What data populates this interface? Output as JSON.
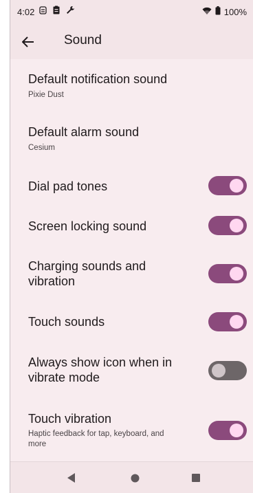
{
  "status": {
    "time": "4:02",
    "battery_pct": "100%"
  },
  "appbar": {
    "title": "Sound"
  },
  "settings": [
    {
      "title": "Default notification sound",
      "subtitle": "Pixie Dust"
    },
    {
      "title": "Default alarm sound",
      "subtitle": "Cesium"
    },
    {
      "title": "Dial pad tones",
      "state": "on"
    },
    {
      "title": "Screen locking sound",
      "state": "on"
    },
    {
      "title": "Charging sounds and",
      "title2": "vibration",
      "state": "on"
    },
    {
      "title": "Touch sounds",
      "state": "on"
    },
    {
      "title": "Always show icon when in",
      "title2": "vibrate mode",
      "state": "off"
    },
    {
      "title": "Touch vibration",
      "subtitle": "Haptic feedback for tap, keyboard, and",
      "subtitle2": "more",
      "state": "on"
    }
  ],
  "colors": {
    "accent": "#8b4a7c",
    "background": "#f8ecef",
    "toggle_off": "#6d6668"
  }
}
